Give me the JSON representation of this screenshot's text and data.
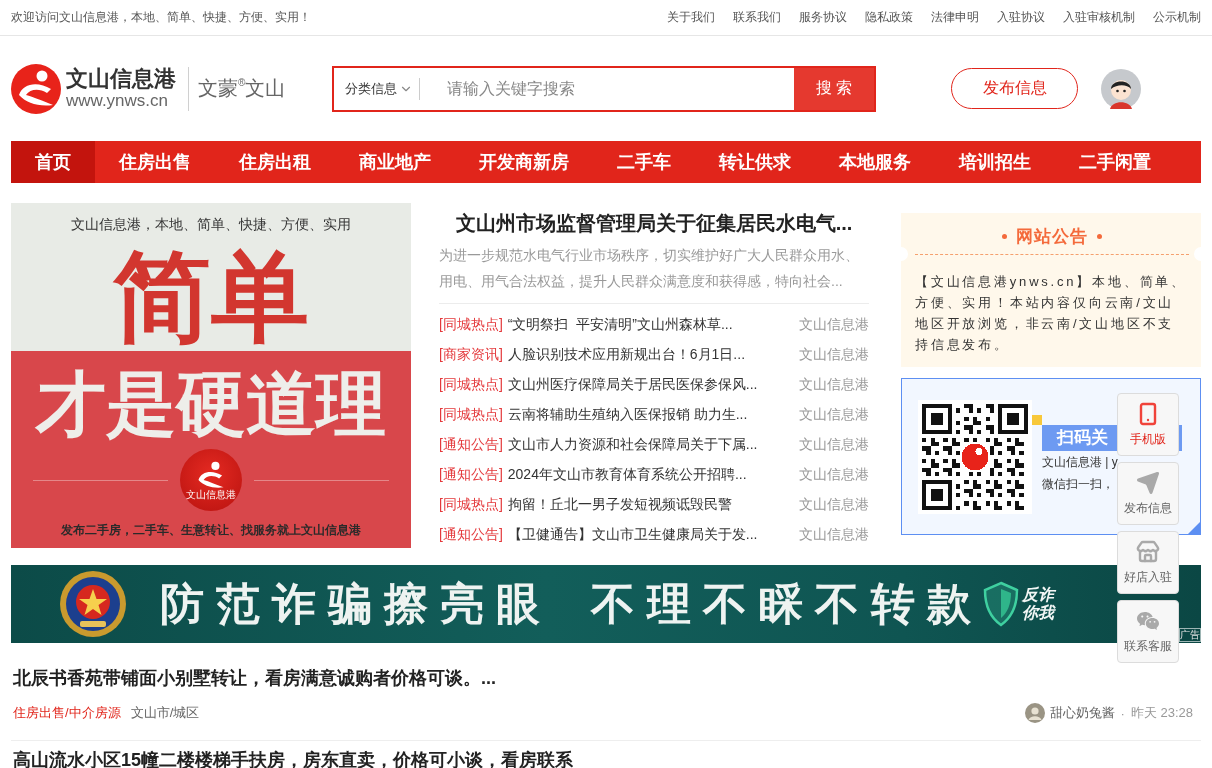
{
  "top_bar": {
    "welcome": "欢迎访问文山信息港，本地、简单、快捷、方便、实用！",
    "links": [
      "关于我们",
      "联系我们",
      "服务协议",
      "隐私政策",
      "法律申明",
      "入驻协议",
      "入驻审核机制",
      "公示机制"
    ]
  },
  "header": {
    "brand": {
      "name": "文山信息港",
      "url": "www.ynws.cn",
      "slogan": "文蒙$^{®}$文山"
    },
    "search": {
      "category": "分类信息",
      "placeholder": "请输入关键字搜索",
      "button": "搜 索"
    },
    "publish_button": "发布信息"
  },
  "nav": [
    {
      "label": "首页",
      "selected": true
    },
    {
      "label": "住房出售",
      "selected": false
    },
    {
      "label": "住房出租",
      "selected": false
    },
    {
      "label": "商业地产",
      "selected": false
    },
    {
      "label": "开发商新房",
      "selected": false
    },
    {
      "label": "二手车",
      "selected": false
    },
    {
      "label": "转让供求",
      "selected": false
    },
    {
      "label": "本地服务",
      "selected": false
    },
    {
      "label": "培训招生",
      "selected": false
    },
    {
      "label": "二手闲置",
      "selected": false
    }
  ],
  "promo": {
    "tagline": "文山信息港，本地、简单、快捷、方便、实用",
    "headline": "简单",
    "subline": "才是硬道理",
    "badge_caption": "文山信息港",
    "footer": "发布二手房，二手车、生意转让、找服务就上文山信息港"
  },
  "featured": {
    "title": "文山州市场监督管理局关于征集居民水电气...",
    "summary": "为进一步规范水电气行业市场秩序，切实维护好广大人民群众用水、用电、用气合法权益，提升人民群众满意度和获得感，特向社会..."
  },
  "news": [
    {
      "tag": "[同城热点]",
      "title": "“文明祭扫  平安清明”文山州森林草...",
      "source": "文山信息港"
    },
    {
      "tag": "[商家资讯]",
      "title": "人脸识别技术应用新规出台！6月1日...",
      "source": "文山信息港"
    },
    {
      "tag": "[同城热点]",
      "title": "文山州医疗保障局关于居民医保参保风...",
      "source": "文山信息港"
    },
    {
      "tag": "[同城热点]",
      "title": "云南将辅助生殖纳入医保报销 助力生...",
      "source": "文山信息港"
    },
    {
      "tag": "[通知公告]",
      "title": "文山市人力资源和社会保障局关于下属...",
      "source": "文山信息港"
    },
    {
      "tag": "[通知公告]",
      "title": "2024年文山市教育体育系统公开招聘...",
      "source": "文山信息港"
    },
    {
      "tag": "[同城热点]",
      "title": "拘留！丘北一男子发短视频诋毁民警",
      "source": "文山信息港"
    },
    {
      "tag": "[通知公告]",
      "title": "【卫健通告】文山市卫生健康局关于发...",
      "source": "文山信息港"
    }
  ],
  "notice": {
    "title": "网站公告",
    "text": "【文山信息港ynws.cn】本地、简单、方便、实用！本站内容仅向云南/文山地区开放浏览，非云南/文山地区不支持信息发布。"
  },
  "qr_card": {
    "heading": "扫码关",
    "lines": [
      "文山信息港 | y",
      "微信扫一扫，"
    ]
  },
  "ad_banner": {
    "slogans": [
      "防范诈骗擦亮眼",
      "不理不睬不转款"
    ],
    "badge_lines": [
      "反诈",
      "你我"
    ],
    "label": "广告"
  },
  "listings": [
    {
      "title": "北辰书香苑带铺面小别墅转让，看房满意诚购者价格可谈。...",
      "category": "住房出售/中介房源",
      "area": "文山市/城区",
      "user": "甜心奶兔酱",
      "separator": "·",
      "time": "昨天 23:28"
    },
    {
      "title": "高山流水小区15幢二楼楼梯手扶房，房东直卖，价格可小谈，看房联系"
    }
  ],
  "float_bar": [
    {
      "label": "手机版",
      "kind": "phone",
      "selected": true
    },
    {
      "label": "发布信息",
      "kind": "send",
      "selected": false
    },
    {
      "label": "好店入驻",
      "kind": "shop",
      "selected": false
    },
    {
      "label": "联系客服",
      "kind": "chat",
      "selected": false
    }
  ]
}
